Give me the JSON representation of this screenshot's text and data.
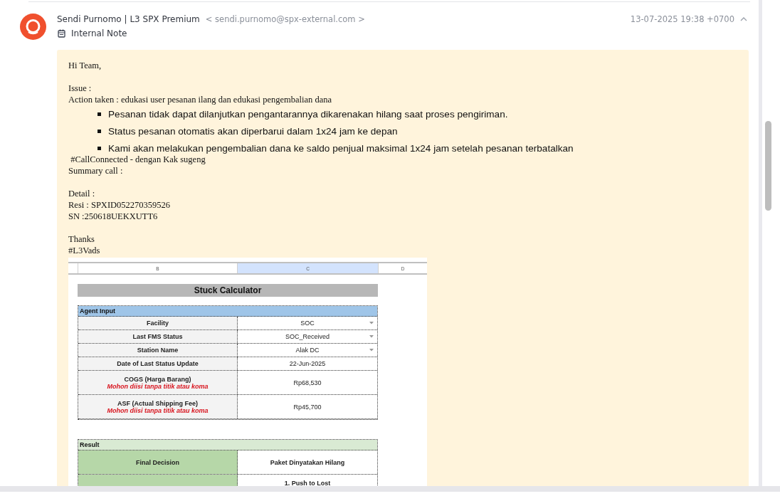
{
  "message": {
    "sender_name": "Sendi Purnomo | L3 SPX Premium",
    "sender_email": "< sendi.purnomo@spx-external.com >",
    "timestamp": "13-07-2025 19:38 +0700",
    "expanded": true,
    "note_type": "Internal Note"
  },
  "note": {
    "blocks": [
      {
        "kind": "lines",
        "lines": [
          "Hi Team,"
        ]
      },
      {
        "kind": "lines",
        "lines": [
          "Issue :",
          "Action taken : edukasi user pesanan ilang dan edukasi pengembalian dana"
        ]
      },
      {
        "kind": "bullets",
        "items": [
          "Pesanan tidak dapat dilanjutkan pengantarannya dikarenakan hilang saat proses pengiriman.",
          "Status pesanan otomatis akan diperbarui dalam 1x24 jam ke depan",
          "Kami akan melakukan pengembalian dana ke saldo penjual maksimal 1x24 jam setelah pesanan terbatalkan"
        ]
      },
      {
        "kind": "lines",
        "lines": [
          " #CallConnected - dengan Kak sugeng",
          "Summary call :"
        ]
      },
      {
        "kind": "lines",
        "lines": [
          "Detail :",
          "Resi : SPXID052270359526",
          "SN :250618UEKXUTT6"
        ]
      },
      {
        "kind": "lines",
        "lines": [
          "Thanks",
          "#L3Vads"
        ]
      }
    ],
    "sheet": {
      "columns": [
        {
          "label": "B",
          "selected": false
        },
        {
          "label": "C",
          "selected": true
        },
        {
          "label": "D",
          "selected": false
        }
      ],
      "title": "Stuck Calculator",
      "sections": [
        {
          "kind": "input",
          "heading": "Agent Input",
          "rows": [
            {
              "label": "Facility",
              "value": "SOC",
              "dropdown": true
            },
            {
              "label": "Last FMS Status",
              "value": "SOC_Received",
              "dropdown": true
            },
            {
              "label": "Station Name",
              "value": "Alak DC",
              "dropdown": true
            },
            {
              "label": "Date of Last Status Update",
              "value": "22-Jun-2025",
              "dropdown": false
            },
            {
              "label": "COGS (Harga Barang)",
              "hint": "Mohon diisi tanpa titik atau koma",
              "value": "Rp68,530",
              "dropdown": false
            },
            {
              "label": "ASF (Actual Shipping Fee)",
              "hint": "Mohon diisi tanpa titik atau koma",
              "value": "Rp45,700",
              "dropdown": false
            }
          ]
        },
        {
          "kind": "result",
          "heading": "Result",
          "rows": [
            {
              "label": "Final Decision",
              "value": "Paket Dinyatakan Hilang",
              "dropdown": false
            },
            {
              "value": "1. Push to Lost",
              "dropdown": false
            }
          ]
        }
      ]
    }
  }
}
